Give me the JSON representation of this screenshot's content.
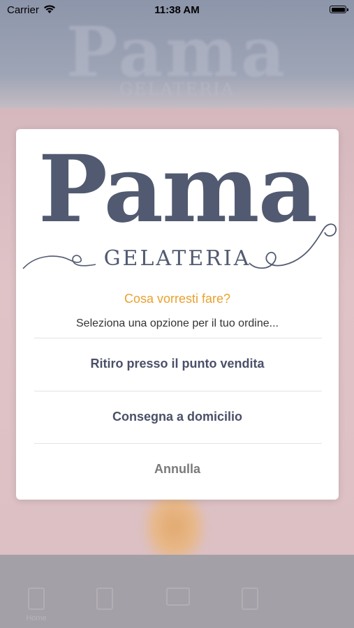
{
  "status_bar": {
    "carrier": "Carrier",
    "time": "11:38 AM"
  },
  "background": {
    "logo_text": "Pama",
    "logo_sub": "GELATERIA"
  },
  "dialog": {
    "logo_text": "Pama",
    "logo_sub": "GELATERIA",
    "question": "Cosa vorresti fare?",
    "hint": "Seleziona una opzione per il tuo ordine...",
    "options": [
      {
        "label": "Ritiro presso il punto vendita"
      },
      {
        "label": "Consegna a domicilio"
      }
    ],
    "cancel_label": "Annulla"
  },
  "tab_bar": {
    "items": [
      {
        "label": "Home"
      },
      {
        "label": ""
      },
      {
        "label": ""
      },
      {
        "label": ""
      }
    ]
  },
  "colors": {
    "accent": "#e9a130",
    "brand": "#515a70",
    "option_text": "#4a5068"
  }
}
